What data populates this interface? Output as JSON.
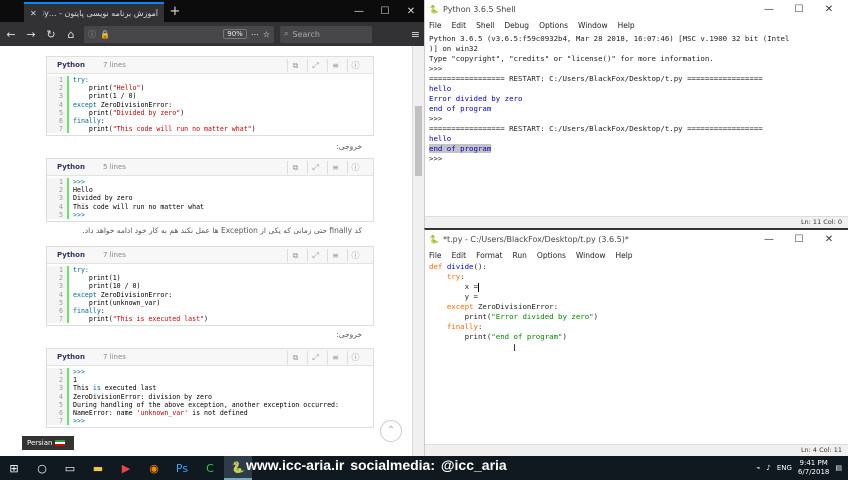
{
  "browser": {
    "tab_title": "آموزش برنامه نویسی پایتون - ...By",
    "url_zoom": "90%",
    "search_placeholder": "Search",
    "new_tab": "+",
    "window_controls": {
      "minimize": "—",
      "maximize": "☐",
      "close": "✕"
    }
  },
  "codeblocks": [
    {
      "lang": "Python",
      "lines": "7 lines",
      "code": [
        [
          {
            "t": "try:",
            "c": "kw"
          }
        ],
        [
          {
            "t": "    print(",
            "c": ""
          },
          {
            "t": "\"Hello\"",
            "c": "st"
          },
          {
            "t": ")",
            "c": ""
          }
        ],
        [
          {
            "t": "    print(1 / 0)",
            "c": ""
          }
        ],
        [
          {
            "t": "except",
            "c": "kw"
          },
          {
            "t": " ZeroDivisionError:",
            "c": ""
          }
        ],
        [
          {
            "t": "    print(",
            "c": ""
          },
          {
            "t": "\"Divided by zero\"",
            "c": "st"
          },
          {
            "t": ")",
            "c": ""
          }
        ],
        [
          {
            "t": "finally",
            "c": "kw"
          },
          {
            "t": ":",
            "c": ""
          }
        ],
        [
          {
            "t": "    print(",
            "c": ""
          },
          {
            "t": "\"This code will run no matter what\"",
            "c": "st"
          },
          {
            "t": ")",
            "c": ""
          }
        ]
      ]
    },
    {
      "lang": "Python",
      "lines": "5 lines",
      "code": [
        [
          {
            "t": ">>>",
            "c": "kw"
          }
        ],
        [
          {
            "t": "Hello",
            "c": ""
          }
        ],
        [
          {
            "t": "Divided by zero",
            "c": ""
          }
        ],
        [
          {
            "t": "This code will run no matter what",
            "c": ""
          }
        ],
        [
          {
            "t": ">>>",
            "c": "kw"
          }
        ]
      ]
    },
    {
      "lang": "Python",
      "lines": "7 lines",
      "code": [
        [
          {
            "t": "try:",
            "c": "kw"
          }
        ],
        [
          {
            "t": "    print(1)",
            "c": ""
          }
        ],
        [
          {
            "t": "    print(10 / 0)",
            "c": ""
          }
        ],
        [
          {
            "t": "except",
            "c": "kw"
          },
          {
            "t": " ZeroDivisionError:",
            "c": ""
          }
        ],
        [
          {
            "t": "    print(unknown_var)",
            "c": ""
          }
        ],
        [
          {
            "t": "finally",
            "c": "kw"
          },
          {
            "t": ":",
            "c": ""
          }
        ],
        [
          {
            "t": "    print(",
            "c": ""
          },
          {
            "t": "\"This is executed last\"",
            "c": "st"
          },
          {
            "t": ")",
            "c": ""
          }
        ]
      ]
    },
    {
      "lang": "Python",
      "lines": "7 lines",
      "code": [
        [
          {
            "t": ">>>",
            "c": "kw"
          }
        ],
        [
          {
            "t": "1",
            "c": ""
          }
        ],
        [
          {
            "t": "This ",
            "c": ""
          },
          {
            "t": "is",
            "c": "kw"
          },
          {
            "t": " executed last",
            "c": ""
          }
        ],
        [
          {
            "t": "ZeroDivisionError: division by zero",
            "c": ""
          }
        ],
        [
          {
            "t": "During handling of the above exception, another exception occurred:",
            "c": ""
          }
        ],
        [
          {
            "t": "NameError: name ",
            "c": ""
          },
          {
            "t": "'unknown_var'",
            "c": "st"
          },
          {
            "t": " is not defined",
            "c": ""
          }
        ],
        [
          {
            "t": ">>>",
            "c": "kw"
          }
        ]
      ]
    }
  ],
  "rtl_texts": {
    "output_label_1": "خروجی:",
    "finally_note": "کد finally حتی زمانی که یکی از Exception ها عمل نکند هم به کار خود ادامه خواهد داد.",
    "output_label_2": "خروجی:"
  },
  "language_badge": "Persian",
  "shell": {
    "title": "Python 3.6.5 Shell",
    "menu": [
      "File",
      "Edit",
      "Shell",
      "Debug",
      "Options",
      "Window",
      "Help"
    ],
    "status": "Ln: 11   Col: 0",
    "lines": [
      {
        "t": "Python 3.6.5 (v3.6.5:f59c0932b4, Mar 28 2018, 16:07:46) [MSC v.1900 32 bit (Intel",
        "c": ""
      },
      {
        "t": ")] on win32",
        "c": ""
      },
      {
        "t": "Type \"copyright\", \"credits\" or \"license()\" for more information.",
        "c": ""
      },
      {
        "t": ">>>",
        "c": ""
      },
      {
        "t": "================= RESTART: C:/Users/BlackFox/Desktop/t.py =================",
        "c": ""
      },
      {
        "t": "hello",
        "c": "out"
      },
      {
        "t": "Error divided by zero",
        "c": "out"
      },
      {
        "t": "end of program",
        "c": "out"
      },
      {
        "t": ">>>",
        "c": ""
      },
      {
        "t": "================= RESTART: C:/Users/BlackFox/Desktop/t.py =================",
        "c": ""
      },
      {
        "t": "hello",
        "c": "out"
      },
      {
        "t": "end of program",
        "c": "out hl"
      },
      {
        "t": ">>>",
        "c": ""
      }
    ]
  },
  "editor": {
    "title": "*t.py - C:/Users/BlackFox/Desktop/t.py (3.6.5)*",
    "menu": [
      "File",
      "Edit",
      "Format",
      "Run",
      "Options",
      "Window",
      "Help"
    ],
    "status": "Ln: 4   Col: 11",
    "lines": [
      [
        {
          "t": "def",
          "c": "ekw"
        },
        {
          "t": " ",
          "c": ""
        },
        {
          "t": "divide",
          "c": "edef"
        },
        {
          "t": "():",
          "c": ""
        }
      ],
      [
        {
          "t": "    ",
          "c": ""
        },
        {
          "t": "try",
          "c": "ekw"
        },
        {
          "t": ":",
          "c": ""
        }
      ],
      [
        {
          "t": "        x =",
          "c": ""
        },
        {
          "t": "|caret",
          "c": "caret"
        }
      ],
      [
        {
          "t": "        y =",
          "c": ""
        }
      ],
      [
        {
          "t": "    ",
          "c": ""
        },
        {
          "t": "except",
          "c": "ekw"
        },
        {
          "t": " ZeroDivisionError:",
          "c": ""
        }
      ],
      [
        {
          "t": "        print(",
          "c": ""
        },
        {
          "t": "\"Error divided by zero\"",
          "c": "est"
        },
        {
          "t": ")",
          "c": ""
        }
      ],
      [
        {
          "t": "    ",
          "c": ""
        },
        {
          "t": "finally",
          "c": "ekw"
        },
        {
          "t": ":",
          "c": ""
        }
      ],
      [
        {
          "t": "        print(",
          "c": ""
        },
        {
          "t": "\"end of program\"",
          "c": "est"
        },
        {
          "t": ")",
          "c": ""
        }
      ]
    ]
  },
  "watermark": "www.icc-aria.ir   socialmedia: @icc_aria",
  "tray": {
    "lang": "ENG",
    "time": "9:41 PM",
    "date": "6/7/2018"
  }
}
